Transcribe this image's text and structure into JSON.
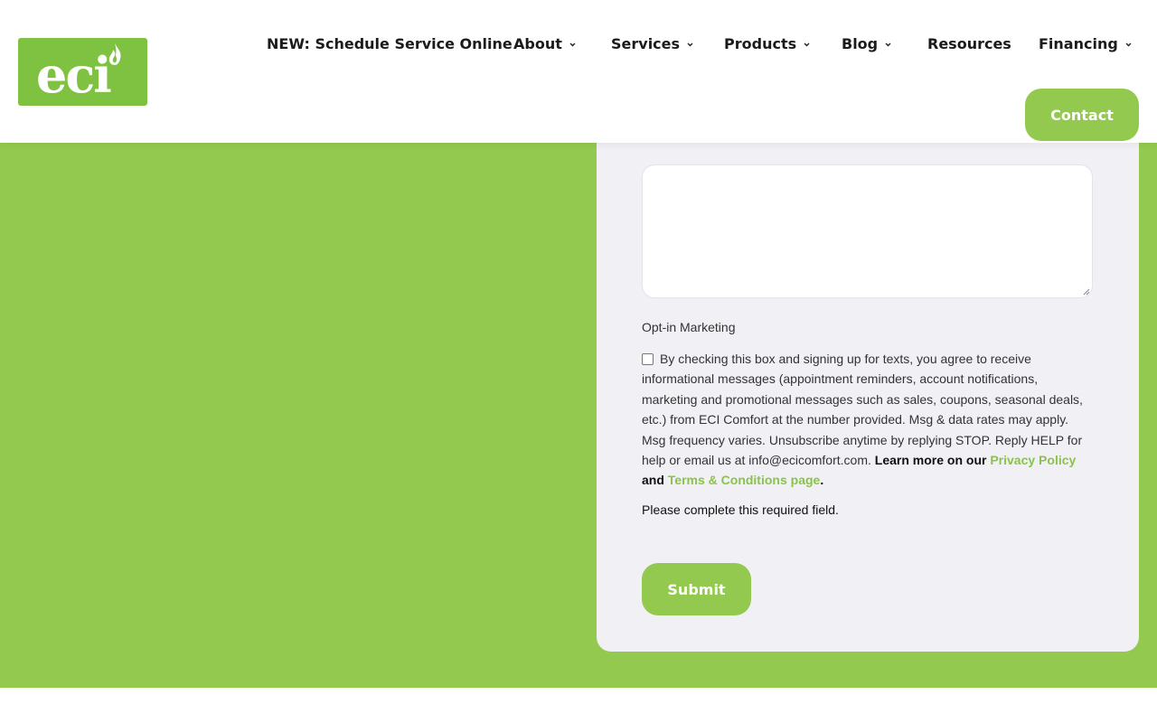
{
  "header": {
    "logo_text": "eci",
    "nav": [
      {
        "label": "NEW: Schedule Service Online",
        "has_dropdown": false
      },
      {
        "label": "About",
        "has_dropdown": true
      },
      {
        "label": "Services",
        "has_dropdown": true
      },
      {
        "label": "Products",
        "has_dropdown": true
      },
      {
        "label": "Blog",
        "has_dropdown": true
      },
      {
        "label": "Resources",
        "has_dropdown": false
      },
      {
        "label": "Financing",
        "has_dropdown": true
      }
    ],
    "contact_label": "Contact"
  },
  "form": {
    "message_value": "",
    "optin_label": "Opt-in Marketing",
    "consent_text": "By checking this box and signing up for texts, you agree to receive informational messages (appointment reminders, account notifications, marketing and promotional messages such as sales, coupons, seasonal deals, etc.) from ECI Comfort at the number provided. Msg & data rates may apply. Msg frequency varies. Unsubscribe anytime by replying STOP. Reply HELP for help or email us at info@ecicomfort.com.",
    "learn_more": "Learn more on our",
    "privacy_link": "Privacy Policy",
    "and_text": "and",
    "terms_link": "Terms & Conditions page",
    "period": ".",
    "checkbox_checked": false,
    "error_text": "Please complete this required field.",
    "submit_label": "Submit"
  },
  "colors": {
    "brand_green": "#93c94e",
    "link_green": "#8bc34a",
    "card_bg": "#f1f0f5"
  }
}
